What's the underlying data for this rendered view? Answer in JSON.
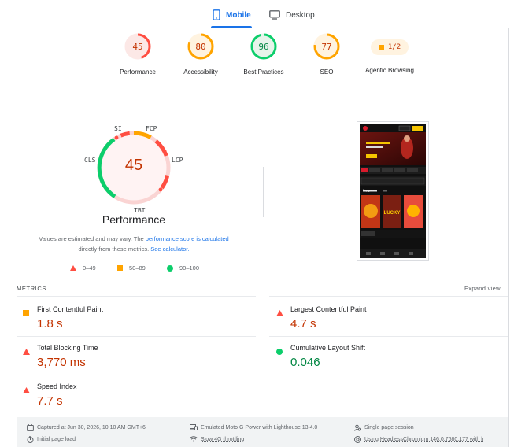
{
  "tabs": {
    "mobile_label": "Mobile",
    "desktop_label": "Desktop"
  },
  "categories": [
    {
      "label": "Performance",
      "score": 45,
      "color": "#ff4e42"
    },
    {
      "label": "Accessibility",
      "score": 80,
      "color": "#ffa400"
    },
    {
      "label": "Best Practices",
      "score": 96,
      "color": "#0cce6b"
    },
    {
      "label": "SEO",
      "score": 77,
      "color": "#ffa400"
    }
  ],
  "agentic": {
    "value": "1/2",
    "label": "Agentic Browsing"
  },
  "performance": {
    "score": "45",
    "title": "Performance",
    "metric_labels": {
      "si": "SI",
      "fcp": "FCP",
      "lcp": "LCP",
      "tbt": "TBT",
      "cls": "CLS"
    },
    "note_prefix": "Values are estimated and may vary. The ",
    "note_link1": "performance score is calculated",
    "note_middle": "directly from these metrics. ",
    "note_link2": "See calculator.",
    "legend": [
      {
        "range": "0–49",
        "shape": "triangle",
        "color": "#ff4e42"
      },
      {
        "range": "50–89",
        "shape": "square",
        "color": "#ffa400"
      },
      {
        "range": "90–100",
        "shape": "circle",
        "color": "#0cce6b"
      }
    ]
  },
  "metrics": {
    "section_label": "METRICS",
    "expand_label": "Expand view",
    "items": [
      {
        "name": "First Contentful Paint",
        "value": "1.8 s",
        "status": "average"
      },
      {
        "name": "Largest Contentful Paint",
        "value": "4.7 s",
        "status": "fail"
      },
      {
        "name": "Total Blocking Time",
        "value": "3,770 ms",
        "status": "fail"
      },
      {
        "name": "Cumulative Layout Shift",
        "value": "0.046",
        "status": "pass"
      },
      {
        "name": "Speed Index",
        "value": "7.7 s",
        "status": "fail"
      }
    ]
  },
  "footer": {
    "captured": "Captured at Jun 30, 2026, 10:10 AM GMT+6",
    "emulated": "Emulated Moto G Power with Lighthouse 13.4.0",
    "session": "Single page session",
    "initial_load": "Initial page load",
    "throttling": "Slow 4G throttling",
    "browser": "Using HeadlessChromium 146.0.7680.177 with lr"
  },
  "phone_screenshot": {
    "top_games_label": "Top games",
    "lucky_label": "LUCKY"
  }
}
